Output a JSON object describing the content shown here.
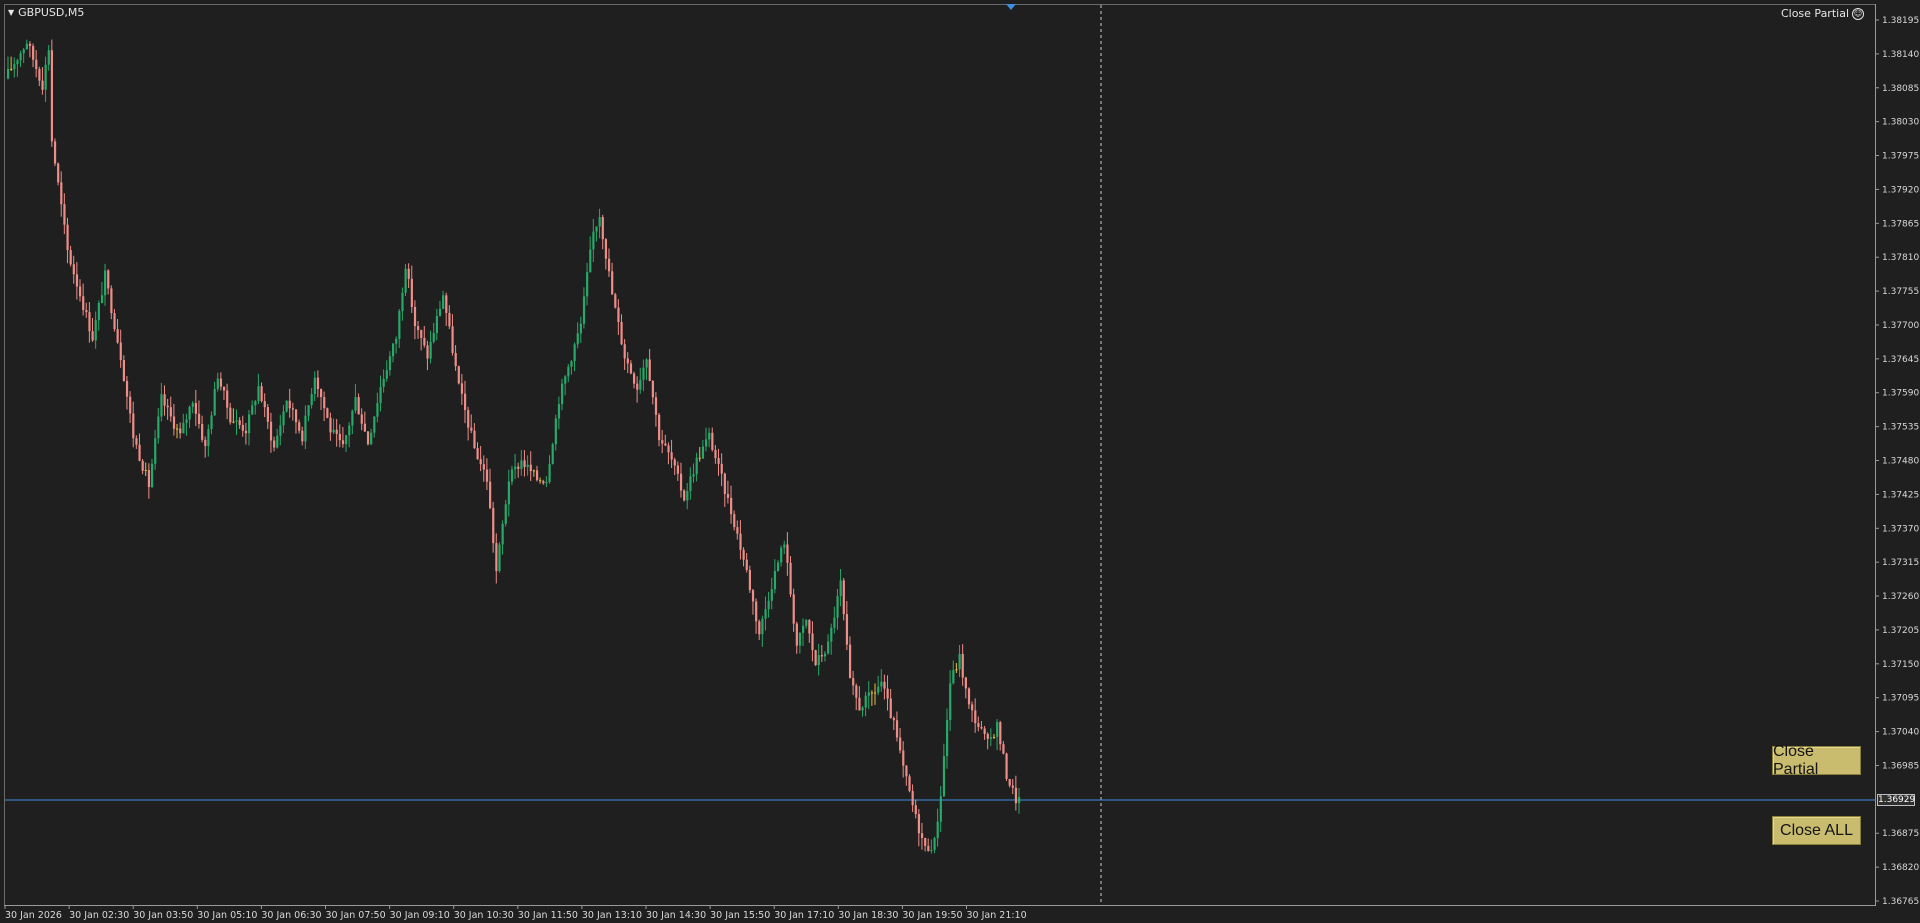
{
  "window": {
    "symbol_timeframe": "GBPUSD,M5",
    "ea_name": "Close Partial",
    "ea_icon": "smiley-icon"
  },
  "buttons": {
    "close_partial_label": "Close Partial",
    "close_all_label": "Close ALL"
  },
  "colors": {
    "background": "#1f1f1f",
    "bull": "#26a969",
    "bear": "#ef8e88",
    "doji": "#e6c13a",
    "bid_line": "#3d8fe0",
    "button": "#c9bc6e"
  },
  "current_price": "1.36929",
  "chart_data": {
    "type": "candlestick",
    "symbol": "GBPUSD",
    "timeframe": "M5",
    "price_axis": {
      "ticks": [
        "1.38195",
        "1.38140",
        "1.38085",
        "1.38030",
        "1.37975",
        "1.37920",
        "1.37865",
        "1.37810",
        "1.37755",
        "1.37700",
        "1.37645",
        "1.37590",
        "1.37535",
        "1.37480",
        "1.37425",
        "1.37370",
        "1.37315",
        "1.37260",
        "1.37205",
        "1.37150",
        "1.37095",
        "1.37040",
        "1.36985",
        "1.36875",
        "1.36820",
        "1.36765"
      ],
      "range": [
        1.36765,
        1.38195
      ]
    },
    "time_axis": {
      "ticks": [
        "30 Jan 2026",
        "30 Jan 02:30",
        "30 Jan 03:50",
        "30 Jan 05:10",
        "30 Jan 06:30",
        "30 Jan 07:50",
        "30 Jan 09:10",
        "30 Jan 10:30",
        "30 Jan 11:50",
        "30 Jan 13:10",
        "30 Jan 14:30",
        "30 Jan 15:50",
        "30 Jan 17:10",
        "30 Jan 18:30",
        "30 Jan 19:50",
        "30 Jan 21:10"
      ]
    },
    "bid_line": 1.36929,
    "price_path": [
      [
        0,
        1.381
      ],
      [
        7,
        1.3816
      ],
      [
        12,
        1.3809
      ],
      [
        14,
        1.3815
      ],
      [
        15,
        1.38
      ],
      [
        20,
        1.3782
      ],
      [
        24,
        1.3775
      ],
      [
        28,
        1.3768
      ],
      [
        32,
        1.3778
      ],
      [
        37,
        1.3765
      ],
      [
        41,
        1.3752
      ],
      [
        46,
        1.3744
      ],
      [
        50,
        1.3758
      ],
      [
        56,
        1.3752
      ],
      [
        60,
        1.3758
      ],
      [
        64,
        1.375
      ],
      [
        68,
        1.3762
      ],
      [
        72,
        1.3755
      ],
      [
        77,
        1.3753
      ],
      [
        81,
        1.376
      ],
      [
        86,
        1.375
      ],
      [
        90,
        1.3758
      ],
      [
        95,
        1.3752
      ],
      [
        99,
        1.3762
      ],
      [
        104,
        1.3753
      ],
      [
        108,
        1.375
      ],
      [
        112,
        1.3758
      ],
      [
        116,
        1.3751
      ],
      [
        120,
        1.376
      ],
      [
        125,
        1.3768
      ],
      [
        128,
        1.378
      ],
      [
        131,
        1.377
      ],
      [
        135,
        1.3765
      ],
      [
        140,
        1.3775
      ],
      [
        145,
        1.376
      ],
      [
        150,
        1.375
      ],
      [
        154,
        1.3745
      ],
      [
        157,
        1.373
      ],
      [
        161,
        1.3745
      ],
      [
        165,
        1.3748
      ],
      [
        170,
        1.3745
      ],
      [
        173,
        1.3745
      ],
      [
        177,
        1.3758
      ],
      [
        181,
        1.3765
      ],
      [
        184,
        1.377
      ],
      [
        186,
        1.3778
      ],
      [
        188,
        1.3785
      ],
      [
        190,
        1.3788
      ],
      [
        194,
        1.3775
      ],
      [
        198,
        1.3765
      ],
      [
        202,
        1.376
      ],
      [
        205,
        1.3765
      ],
      [
        209,
        1.3752
      ],
      [
        213,
        1.3748
      ],
      [
        217,
        1.3742
      ],
      [
        221,
        1.3748
      ],
      [
        225,
        1.3752
      ],
      [
        229,
        1.3745
      ],
      [
        233,
        1.3738
      ],
      [
        237,
        1.373
      ],
      [
        241,
        1.372
      ],
      [
        245,
        1.3728
      ],
      [
        249,
        1.3735
      ],
      [
        253,
        1.3718
      ],
      [
        256,
        1.3722
      ],
      [
        259,
        1.3715
      ],
      [
        263,
        1.3718
      ],
      [
        267,
        1.3728
      ],
      [
        270,
        1.3712
      ],
      [
        273,
        1.3708
      ],
      [
        277,
        1.371
      ],
      [
        280,
        1.3712
      ],
      [
        284,
        1.3705
      ],
      [
        287,
        1.3698
      ],
      [
        291,
        1.369
      ],
      [
        294,
        1.3685
      ],
      [
        297,
        1.3686
      ],
      [
        299,
        1.3694
      ],
      [
        302,
        1.3712
      ],
      [
        305,
        1.3716
      ],
      [
        308,
        1.3708
      ],
      [
        311,
        1.3705
      ],
      [
        314,
        1.3702
      ],
      [
        317,
        1.3705
      ],
      [
        320,
        1.3697
      ],
      [
        323,
        1.3693
      ]
    ]
  }
}
